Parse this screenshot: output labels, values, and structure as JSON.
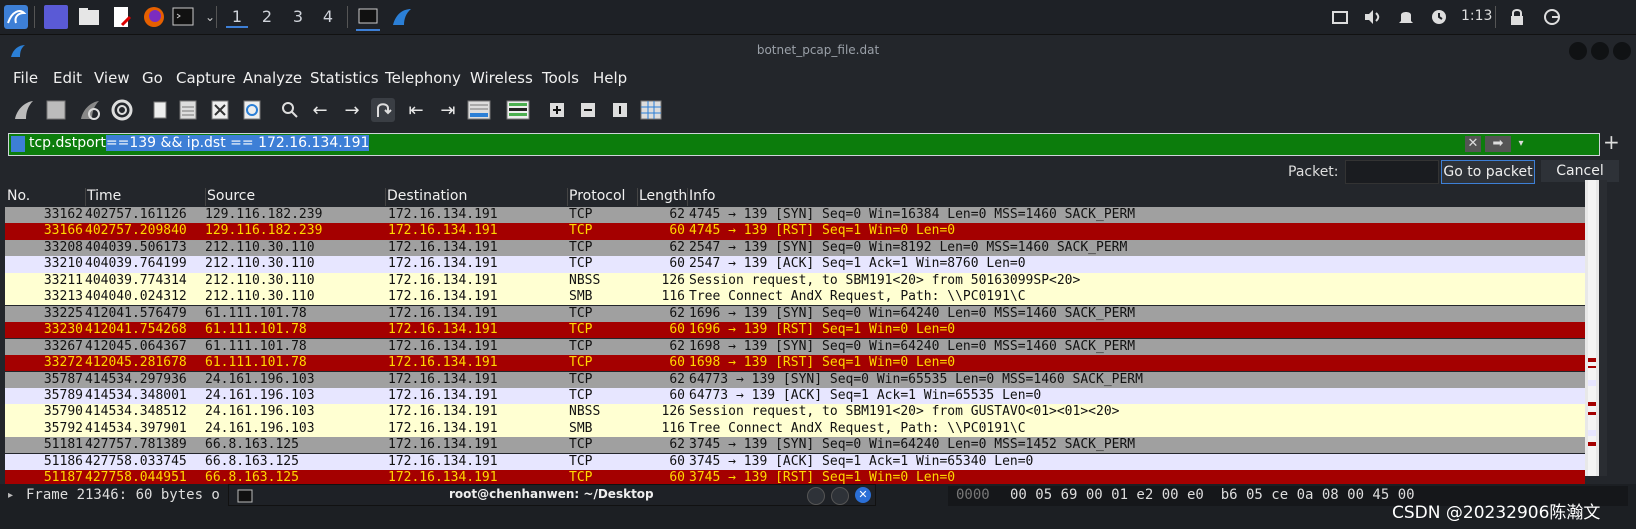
{
  "taskbar": {
    "workspaces": [
      "1",
      "2",
      "3",
      "4"
    ],
    "clock": "1:13"
  },
  "window": {
    "title": "botnet_pcap_file.dat"
  },
  "menu": [
    "File",
    "Edit",
    "View",
    "Go",
    "Capture",
    "Analyze",
    "Statistics",
    "Telephony",
    "Wireless",
    "Tools",
    "Help"
  ],
  "filter": {
    "text_a": "tcp.dstport",
    "text_b": "==139 && ip.dst == 172.16.134.191"
  },
  "goto": {
    "label": "Packet:",
    "go_button": "Go to packet",
    "cancel_button": "Cancel"
  },
  "columns": [
    "No.",
    "Time",
    "Source",
    "Destination",
    "Protocol",
    "Length",
    "Info"
  ],
  "rows": [
    {
      "no": "33162",
      "time": "402757.161126",
      "src": "129.116.182.239",
      "dst": "172.16.134.191",
      "proto": "TCP",
      "len": "62",
      "info": "4745 → 139 [SYN] Seq=0 Win=16384 Len=0 MSS=1460 SACK_PERM",
      "color": "gray"
    },
    {
      "no": "33166",
      "time": "402757.209840",
      "src": "129.116.182.239",
      "dst": "172.16.134.191",
      "proto": "TCP",
      "len": "60",
      "info": "4745 → 139 [RST] Seq=1 Win=0 Len=0",
      "color": "red"
    },
    {
      "no": "33208",
      "time": "404039.506173",
      "src": "212.110.30.110",
      "dst": "172.16.134.191",
      "proto": "TCP",
      "len": "62",
      "info": "2547 → 139 [SYN] Seq=0 Win=8192 Len=0 MSS=1460 SACK_PERM",
      "color": "gray"
    },
    {
      "no": "33210",
      "time": "404039.764199",
      "src": "212.110.30.110",
      "dst": "172.16.134.191",
      "proto": "TCP",
      "len": "60",
      "info": "2547 → 139 [ACK] Seq=1 Ack=1 Win=8760 Len=0",
      "color": "lav"
    },
    {
      "no": "33211",
      "time": "404039.774314",
      "src": "212.110.30.110",
      "dst": "172.16.134.191",
      "proto": "NBSS",
      "len": "126",
      "info": "Session request, to SBM191<20> from 50163099SP<20>",
      "color": "yel"
    },
    {
      "no": "33213",
      "time": "404040.024312",
      "src": "212.110.30.110",
      "dst": "172.16.134.191",
      "proto": "SMB",
      "len": "116",
      "info": "Tree Connect AndX Request, Path: \\\\PC0191\\C",
      "color": "yel"
    },
    {
      "no": "33225",
      "time": "412041.576479",
      "src": "61.111.101.78",
      "dst": "172.16.134.191",
      "proto": "TCP",
      "len": "62",
      "info": "1696 → 139 [SYN] Seq=0 Win=64240 Len=0 MSS=1460 SACK_PERM",
      "color": "gray"
    },
    {
      "no": "33230",
      "time": "412041.754268",
      "src": "61.111.101.78",
      "dst": "172.16.134.191",
      "proto": "TCP",
      "len": "60",
      "info": "1696 → 139 [RST] Seq=1 Win=0 Len=0",
      "color": "red"
    },
    {
      "no": "33267",
      "time": "412045.064367",
      "src": "61.111.101.78",
      "dst": "172.16.134.191",
      "proto": "TCP",
      "len": "62",
      "info": "1698 → 139 [SYN] Seq=0 Win=64240 Len=0 MSS=1460 SACK_PERM",
      "color": "gray"
    },
    {
      "no": "33272",
      "time": "412045.281678",
      "src": "61.111.101.78",
      "dst": "172.16.134.191",
      "proto": "TCP",
      "len": "60",
      "info": "1698 → 139 [RST] Seq=1 Win=0 Len=0",
      "color": "red"
    },
    {
      "no": "35787",
      "time": "414534.297936",
      "src": "24.161.196.103",
      "dst": "172.16.134.191",
      "proto": "TCP",
      "len": "62",
      "info": "64773 → 139 [SYN] Seq=0 Win=65535 Len=0 MSS=1460 SACK_PERM",
      "color": "gray"
    },
    {
      "no": "35789",
      "time": "414534.348001",
      "src": "24.161.196.103",
      "dst": "172.16.134.191",
      "proto": "TCP",
      "len": "60",
      "info": "64773 → 139 [ACK] Seq=1 Ack=1 Win=65535 Len=0",
      "color": "lav"
    },
    {
      "no": "35790",
      "time": "414534.348512",
      "src": "24.161.196.103",
      "dst": "172.16.134.191",
      "proto": "NBSS",
      "len": "126",
      "info": "Session request, to SBM191<20> from GUSTAVO<01><01><20>",
      "color": "yel"
    },
    {
      "no": "35792",
      "time": "414534.397901",
      "src": "24.161.196.103",
      "dst": "172.16.134.191",
      "proto": "SMB",
      "len": "116",
      "info": "Tree Connect AndX Request, Path: \\\\PC0191\\C",
      "color": "yel"
    },
    {
      "no": "51181",
      "time": "427757.781389",
      "src": "66.8.163.125",
      "dst": "172.16.134.191",
      "proto": "TCP",
      "len": "62",
      "info": "3745 → 139 [SYN] Seq=0 Win=64240 Len=0 MSS=1452 SACK_PERM",
      "color": "gray"
    },
    {
      "no": "51186",
      "time": "427758.033745",
      "src": "66.8.163.125",
      "dst": "172.16.134.191",
      "proto": "TCP",
      "len": "60",
      "info": "3745 → 139 [ACK] Seq=1 Ack=1 Win=65340 Len=0",
      "color": "lav"
    },
    {
      "no": "51187",
      "time": "427758.044951",
      "src": "66.8.163.125",
      "dst": "172.16.134.191",
      "proto": "TCP",
      "len": "60",
      "info": "3745 → 139 [RST] Seq=1 Win=0 Len=0",
      "color": "red"
    }
  ],
  "bottom": {
    "detail": "Frame 21346: 60 bytes o",
    "terminal_title": "root@chenhanwen: ~/Desktop",
    "hex_offset": "0000",
    "hex_bytes": "00 05 69 00 01 e2 00 e0  b6 05 ce 0a 08 00 45 00",
    "watermark": "CSDN @20232906陈瀚文"
  }
}
